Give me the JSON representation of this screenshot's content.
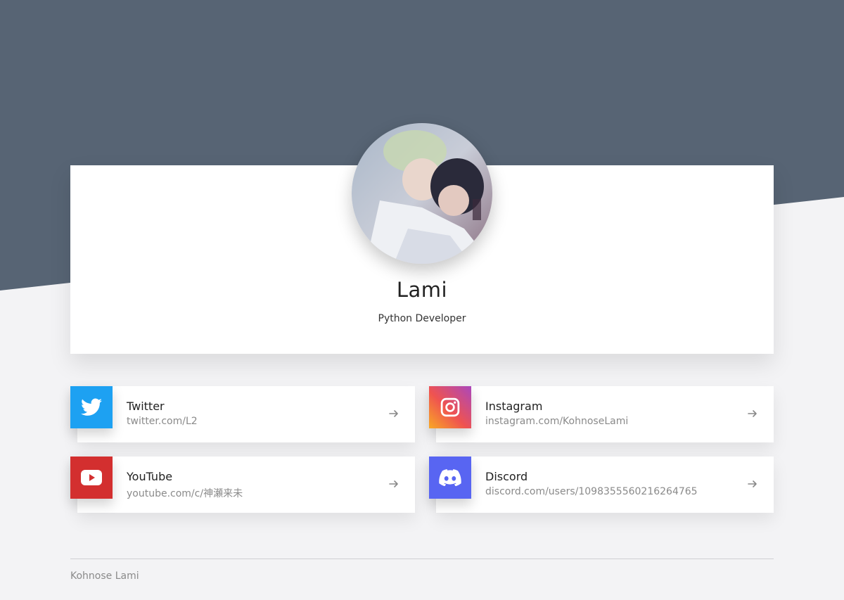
{
  "profile": {
    "name": "Lami",
    "role": "Python Developer"
  },
  "links": [
    {
      "title": "Twitter",
      "url": "twitter.com/L2",
      "icon": "twitter-icon",
      "color": "#1da1f2"
    },
    {
      "title": "Instagram",
      "url": "instagram.com/KohnoseLami",
      "icon": "instagram-icon",
      "color": "#e1306c"
    },
    {
      "title": "YouTube",
      "url": "youtube.com/c/神瀬来未",
      "icon": "youtube-icon",
      "color": "#d32f2f"
    },
    {
      "title": "Discord",
      "url": "discord.com/users/1098355560216264765",
      "icon": "discord-icon",
      "color": "#5865f2"
    }
  ],
  "footer": {
    "text": "Kohnose Lami"
  },
  "colors": {
    "header_bg": "#576474",
    "page_bg": "#f3f3f5"
  }
}
